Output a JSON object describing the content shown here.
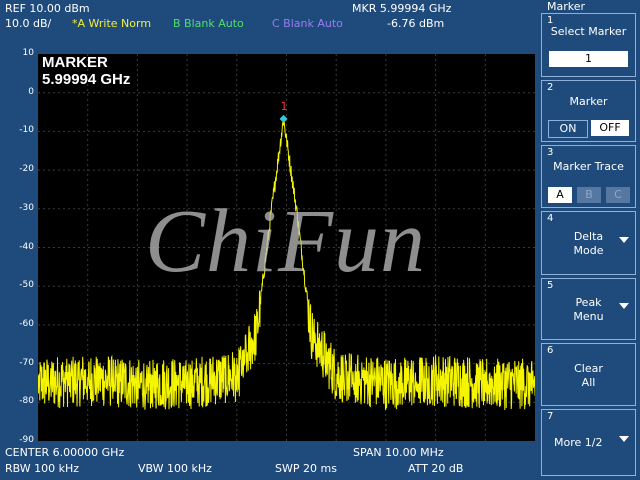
{
  "header": {
    "ref": "REF  10.00 dBm",
    "scale": "10.0 dB/",
    "traceA": "*A Write Norm",
    "traceB": "B Blank Auto",
    "traceC": "C Blank Auto",
    "mkr_freq": "MKR 5.99994 GHz",
    "mkr_level": "-6.76 dBm"
  },
  "plot": {
    "marker_title": "MARKER",
    "marker_freq": "5.99994 GHz",
    "marker_label": "1",
    "watermark": "ChiFun",
    "y_ticks": [
      "10",
      "0",
      "-10",
      "-20",
      "-30",
      "-40",
      "-50",
      "-60",
      "-70",
      "-80",
      "-90"
    ]
  },
  "footer": {
    "center": "CENTER 6.00000 GHz",
    "span": "SPAN 10.00 MHz",
    "rbw": "RBW  100 kHz",
    "vbw": "VBW  100 kHz",
    "swp": "SWP  20 ms",
    "att": "ATT 20 dB"
  },
  "softkeys": {
    "title": "Marker",
    "k1": {
      "num": "1",
      "label": "Select Marker",
      "value": "1"
    },
    "k2": {
      "num": "2",
      "label": "Marker",
      "on": "ON",
      "off": "OFF"
    },
    "k3": {
      "num": "3",
      "label": "Marker Trace",
      "a": "A",
      "b": "B",
      "c": "C"
    },
    "k4": {
      "num": "4",
      "line1": "Delta",
      "line2": "Mode"
    },
    "k5": {
      "num": "5",
      "line1": "Peak",
      "line2": "Menu"
    },
    "k6": {
      "num": "6",
      "line1": "Clear",
      "line2": "All"
    },
    "k7": {
      "num": "7",
      "label": "More 1/2"
    }
  },
  "chart_data": {
    "type": "line",
    "title": "",
    "xlabel": "",
    "ylabel": "",
    "x_center_ghz": 6.0,
    "x_span_mhz": 10.0,
    "ylim": [
      -90,
      10
    ],
    "series": [
      {
        "x_mhz_offset": [
          -5,
          -4,
          -3,
          -2,
          -1,
          -0.6,
          -0.3,
          -0.06,
          0.2,
          0.5,
          1,
          2,
          3,
          4,
          5
        ],
        "y_dbm": [
          -75,
          -74,
          -75,
          -75,
          -73,
          -62,
          -30,
          -6.76,
          -30,
          -62,
          -73,
          -75,
          -74,
          -75,
          -75
        ]
      }
    ],
    "marker": {
      "freq_ghz": 5.99994,
      "level_dbm": -6.76
    },
    "trace_color": "#f5f500",
    "grid": true
  }
}
